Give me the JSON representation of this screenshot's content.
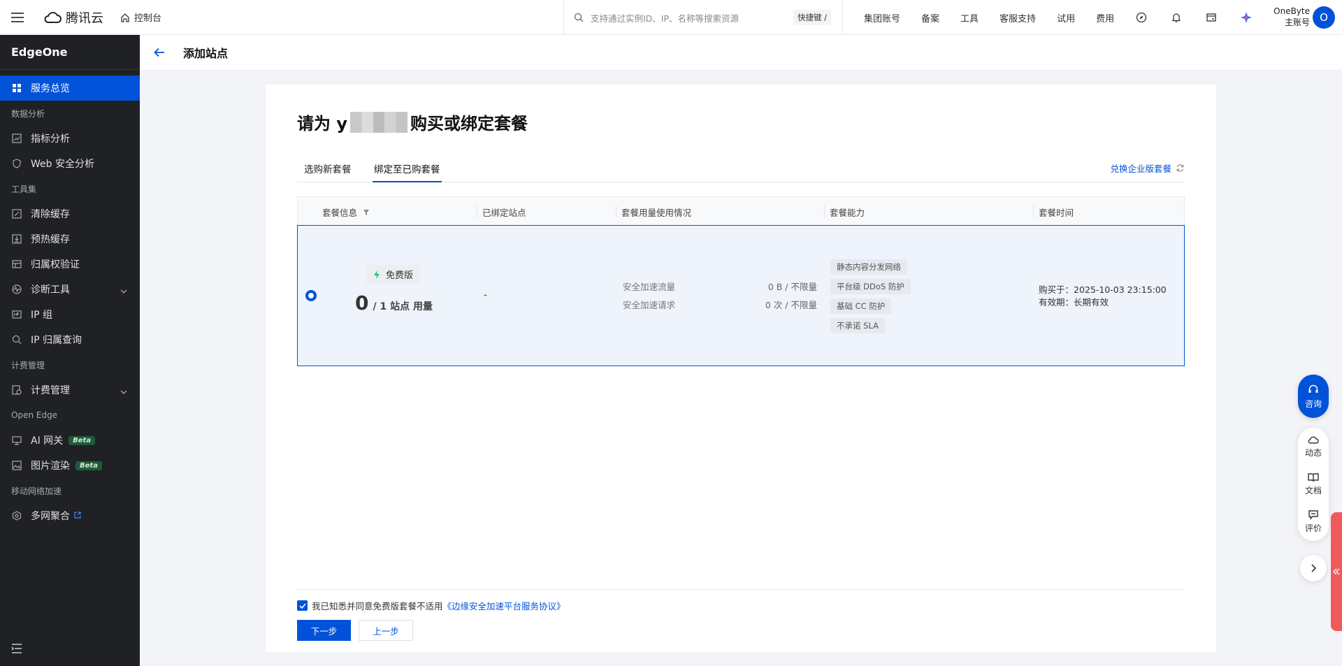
{
  "topbar": {
    "brand": "腾讯云",
    "console": "控制台",
    "search_placeholder": "支持通过实例ID、IP、名称等搜索资源",
    "shortcut": "快捷键 /",
    "nav": [
      "集团账号",
      "备案",
      "工具",
      "客服支持",
      "试用",
      "费用"
    ],
    "account_line1": "OneByte",
    "account_line2": "主账号",
    "avatar": "O"
  },
  "sidebar": {
    "title": "EdgeOne",
    "items": [
      {
        "type": "item",
        "label": "服务总览",
        "icon": "grid-icon",
        "active": true
      },
      {
        "type": "group",
        "label": "数据分析"
      },
      {
        "type": "item",
        "label": "指标分析",
        "icon": "chart-icon"
      },
      {
        "type": "item",
        "label": "Web 安全分析",
        "icon": "shield-icon"
      },
      {
        "type": "group",
        "label": "工具集"
      },
      {
        "type": "item",
        "label": "清除缓存",
        "icon": "clear-icon"
      },
      {
        "type": "item",
        "label": "预热缓存",
        "icon": "download-icon"
      },
      {
        "type": "item",
        "label": "归属权验证",
        "icon": "verify-icon"
      },
      {
        "type": "item",
        "label": "诊断工具",
        "icon": "pulse-icon",
        "chevron": true
      },
      {
        "type": "item",
        "label": "IP 组",
        "icon": "ip-icon"
      },
      {
        "type": "item",
        "label": "IP 归属查询",
        "icon": "search-icon"
      },
      {
        "type": "group",
        "label": "计费管理"
      },
      {
        "type": "item",
        "label": "计费管理",
        "icon": "billing-icon",
        "chevron": true
      },
      {
        "type": "group",
        "label": "Open Edge"
      },
      {
        "type": "item",
        "label": "AI 网关",
        "icon": "gateway-icon",
        "badge": "Beta"
      },
      {
        "type": "item",
        "label": "图片渲染",
        "icon": "image-icon",
        "badge": "Beta"
      },
      {
        "type": "group",
        "label": "移动网络加速"
      },
      {
        "type": "item",
        "label": "多网聚合",
        "icon": "hexagon-icon",
        "external": true
      }
    ]
  },
  "page": {
    "title": "添加站点",
    "heading_prefix": "请为 y",
    "heading_suffix": "购买或绑定套餐",
    "tabs": [
      "选购新套餐",
      "绑定至已购套餐"
    ],
    "active_tab": 1,
    "exchange_link": "兑换企业版套餐"
  },
  "table": {
    "headers": [
      "套餐信息",
      "已绑定站点",
      "套餐用量使用情况",
      "套餐能力",
      "套餐时间"
    ],
    "row": {
      "plan_name": "免费版",
      "usage_count": "0",
      "usage_suffix": "/ 1 站点 用量",
      "bound_sites": "-",
      "metrics": [
        {
          "label": "安全加速流量",
          "value": "0 B / 不限量"
        },
        {
          "label": "安全加速请求",
          "value": "0 次 / 不限量"
        }
      ],
      "capabilities": [
        "静态内容分发网络",
        "平台级 DDoS 防护",
        "基础 CC 防护",
        "不承诺 SLA"
      ],
      "purchased": "购买于：2025-10-03 23:15:00",
      "validity": "有效期：长期有效"
    }
  },
  "footer": {
    "agree_text": "我已知悉并同意免费版套餐不适用",
    "agree_link": "《边缘安全加速平台服务协议》",
    "next": "下一步",
    "prev": "上一步"
  },
  "float": {
    "consult": "咨询",
    "items": [
      "动态",
      "文档",
      "评价"
    ]
  },
  "colors": {
    "primary": "#0052d9",
    "sidebar_bg": "#1f2125",
    "row_selected": "#eef3fc"
  }
}
